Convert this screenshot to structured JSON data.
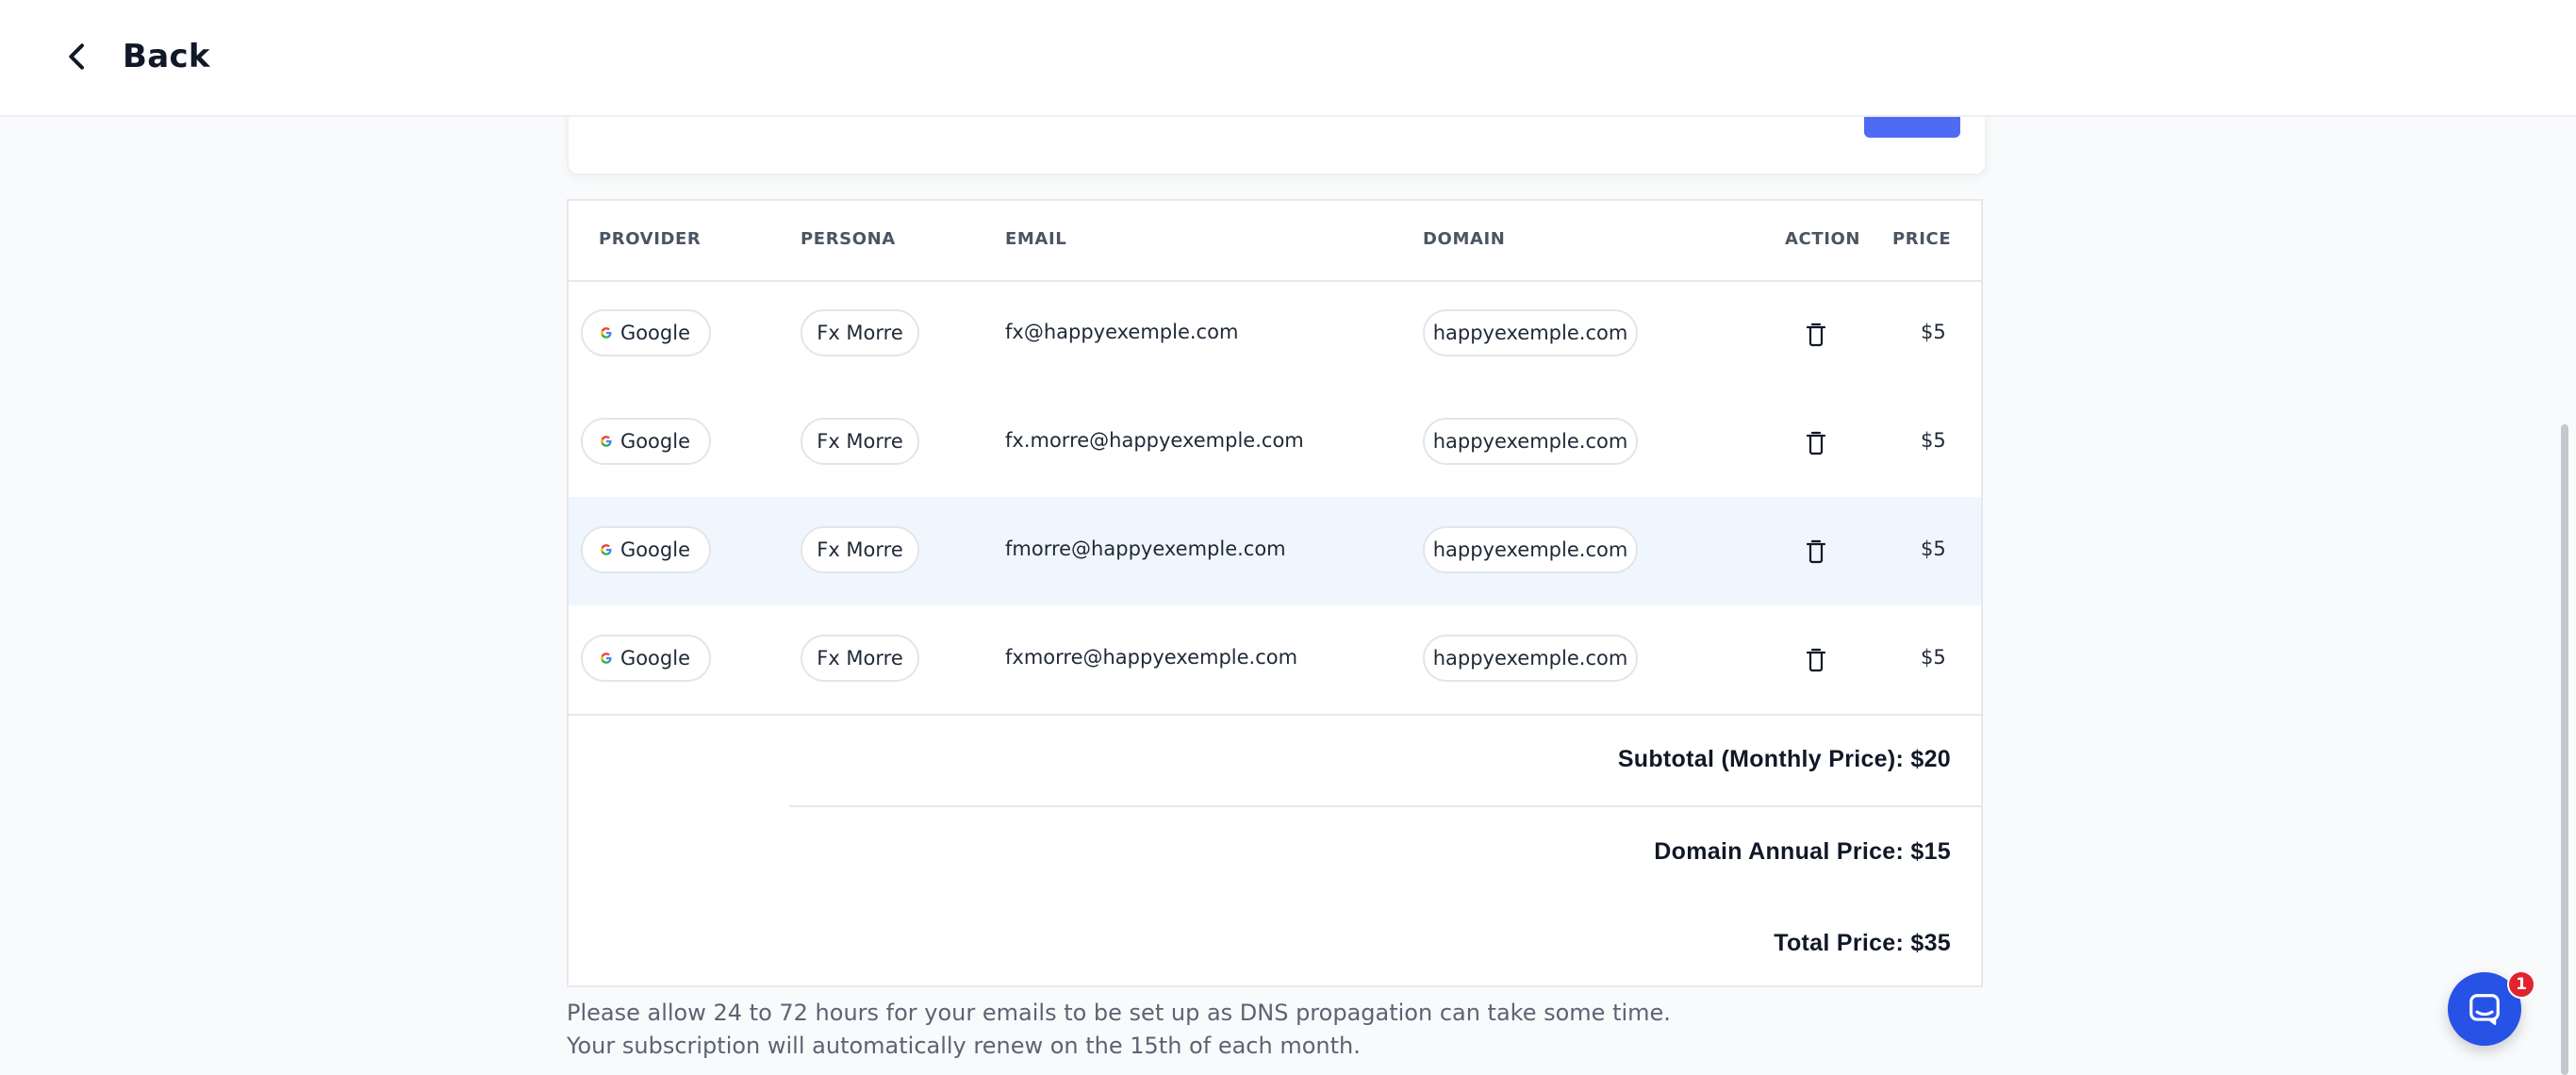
{
  "header": {
    "back_label": "Back"
  },
  "table": {
    "columns": {
      "provider": "PROVIDER",
      "persona": "PERSONA",
      "email": "EMAIL",
      "domain": "DOMAIN",
      "action": "ACTION",
      "price": "PRICE"
    },
    "rows": [
      {
        "provider": "Google",
        "persona": "Fx Morre",
        "email": "fx@happyexemple.com",
        "domain": "happyexemple.com",
        "price": "$5"
      },
      {
        "provider": "Google",
        "persona": "Fx Morre",
        "email": "fx.morre@happyexemple.com",
        "domain": "happyexemple.com",
        "price": "$5"
      },
      {
        "provider": "Google",
        "persona": "Fx Morre",
        "email": "fmorre@happyexemple.com",
        "domain": "happyexemple.com",
        "price": "$5"
      },
      {
        "provider": "Google",
        "persona": "Fx Morre",
        "email": "fxmorre@happyexemple.com",
        "domain": "happyexemple.com",
        "price": "$5"
      }
    ]
  },
  "summary": {
    "subtotal": "Subtotal (Monthly Price): $20",
    "domain_annual": "Domain Annual Price: $15",
    "total": "Total Price: $35"
  },
  "notes": {
    "line1": "Please allow 24 to 72 hours for your emails to be set up as DNS propagation can take some time.",
    "line2": "Your subscription will automatically renew on the 15th of each month."
  },
  "chat": {
    "badge_count": "1"
  },
  "colors": {
    "accent": "#4f6bf5",
    "chat": "#2752e6",
    "highlight_row": "#f0f6fd",
    "badge": "#e0242f"
  }
}
